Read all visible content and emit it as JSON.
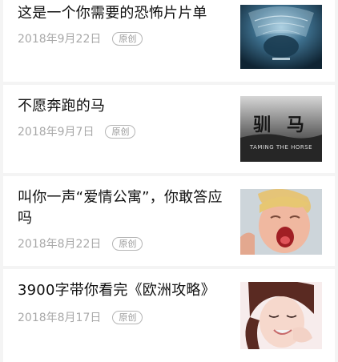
{
  "articles": [
    {
      "title": "这是一个你需要的恐怖片片单",
      "date": "2018年9月22日",
      "badge": "原创",
      "thumb_icon": "horror-movie-poster",
      "thumb_color": "#2b5a78"
    },
    {
      "title": "不愿奔跑的马",
      "date": "2018年9月7日",
      "badge": "原创",
      "thumb_icon": "horse-movie-poster",
      "thumb_color": "#2a2a2a",
      "thumb_caption": "TAMING THE HORSE",
      "thumb_calligraphy": "驯 马"
    },
    {
      "title": "叫你一声“爱情公寓”，你敢答应吗",
      "date": "2018年8月22日",
      "badge": "原创",
      "thumb_icon": "shouting-boy-photo",
      "thumb_color": "#e9b8a3"
    },
    {
      "title": "3900字带你看完《欧洲攻略》",
      "date": "2018年8月17日",
      "badge": "原创",
      "thumb_icon": "smiling-woman-photo",
      "thumb_color": "#f4dcd6"
    }
  ]
}
